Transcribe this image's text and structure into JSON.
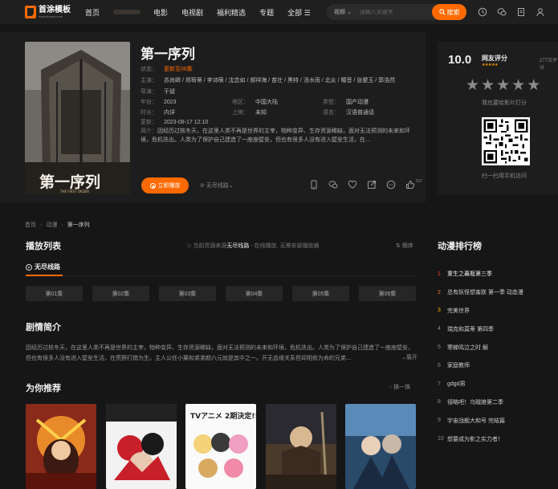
{
  "brand": {
    "name": "首涂模板",
    "sub": "www.shoutu.com"
  },
  "nav": {
    "items": [
      "首页",
      "电影",
      "电视剧",
      "福利精选",
      "专题",
      "全部 ☰"
    ]
  },
  "search": {
    "category": "视频",
    "placeholder": "请输入关键字",
    "button": "搜索"
  },
  "top_icons": [
    "clock-icon",
    "chat-icon",
    "bookmark-icon",
    "user-icon"
  ],
  "detail": {
    "title": "第一序列",
    "status": {
      "label": "状态：",
      "value": "更新至06集"
    },
    "cast": {
      "label": "主演：",
      "value": "苏尚卿 / 郑宥蒂 / 李诗萌 / 沈念如 / 郝祥海 / 苗壮 / 黑特 / 汤水雨 / 北炎 / 瞳音 / 张颦玉 / 郭浩然"
    },
    "director": {
      "label": "导演：",
      "value": "于斌"
    },
    "year": {
      "label": "年份：",
      "value": "2023"
    },
    "region": {
      "label": "地区：",
      "value": "中国大陆"
    },
    "type": {
      "label": "类型：",
      "value": "国产动漫"
    },
    "duration": {
      "label": "时长：",
      "value": "内详"
    },
    "release": {
      "label": "上映：",
      "value": "未知"
    },
    "language": {
      "label": "语言：",
      "value": "汉语普通话"
    },
    "updated": {
      "label": "更新：",
      "value": "2023-08-17 12:10"
    },
    "intro_label": "简介：",
    "intro": "因经历过核冬天，在这里人类不再是世界的主宰，物种变异、生存资源稀缺，面对无法预测的未来和环境，危机迭出。人类为了保护自己建造了一座座壁垒，但也有很多人没有进入壁垒生活，在…",
    "play_button": "立即播放",
    "route_select": "⊘ 无尽线路⌄",
    "action_icons": [
      "phone-icon",
      "wechat-icon",
      "heart-icon",
      "share-icon",
      "chat-bubble-icon",
      "thumbs-up-icon"
    ],
    "like_count": "537",
    "poster_text": "第一序列",
    "poster_sub": "THE FIRST ORDER"
  },
  "rating": {
    "score": "10.0",
    "label": "网友评分",
    "count": "277次评分",
    "mini_stars": "★★★★★",
    "stars": "★★★★★",
    "tip": "我也要给影片打分",
    "qr_tip": "扫一扫用手机访问"
  },
  "breadcrumb": {
    "home": "首页",
    "category": "动漫",
    "current": "第一序列",
    "sep": "›"
  },
  "playlist": {
    "title": "播放列表",
    "tip_prefix": "◇ 当前资源来源",
    "tip_route": "无尽线路",
    "tip_suffix": "- 在线播放, 无需安装播放器",
    "sort": "⇅ 倒序",
    "route_tab": "无尽线路",
    "episodes": [
      "第01集",
      "第02集",
      "第03集",
      "第04集",
      "第05集",
      "第06集"
    ]
  },
  "synopsis": {
    "title": "剧情简介",
    "text": "因经历过核冬天，在这里人类不再是世界的主宰，物种变异、生存资源稀缺，面对无法预测的未来和环境，危机迭出。人类为了保护自己建造了一座座壁垒，但也有很多人没有进入壁垒生活，在荒野打猎为生。主人公任小粟和弟弟颜六元就是其中之一。开无血缘关系但却相依为命的兄弟…",
    "expand": "⌄展开"
  },
  "recommend": {
    "title": "为你推荐",
    "refresh": "◌ 换一换",
    "cards": [
      "rec-1",
      "rec-2",
      "rec-3",
      "rec-4",
      "rec-5"
    ],
    "card3_text": "TVアニメ 2期決定!!!"
  },
  "ranking": {
    "title": "动漫排行榜",
    "items": [
      {
        "no": "1",
        "name": "重生之暮瓶第三季"
      },
      {
        "no": "2",
        "name": "总有妖怪想害朕 第一季 动态漫"
      },
      {
        "no": "3",
        "name": "完美世界"
      },
      {
        "no": "4",
        "name": "瑞克和莫蒂 第四季"
      },
      {
        "no": "5",
        "name": "寒蝉鸣泣之时 解"
      },
      {
        "no": "6",
        "name": "家庭教师"
      },
      {
        "no": "7",
        "name": "gdgd男"
      },
      {
        "no": "8",
        "name": "侵略吧！乌贼娘第二季"
      },
      {
        "no": "9",
        "name": "宇宙战舰大和号 完结篇"
      },
      {
        "no": "10",
        "name": "想要成为影之实力者！"
      }
    ]
  },
  "colors": {
    "accent": "#ff6a00",
    "bg": "#161617",
    "panel": "#1d1d1e"
  }
}
